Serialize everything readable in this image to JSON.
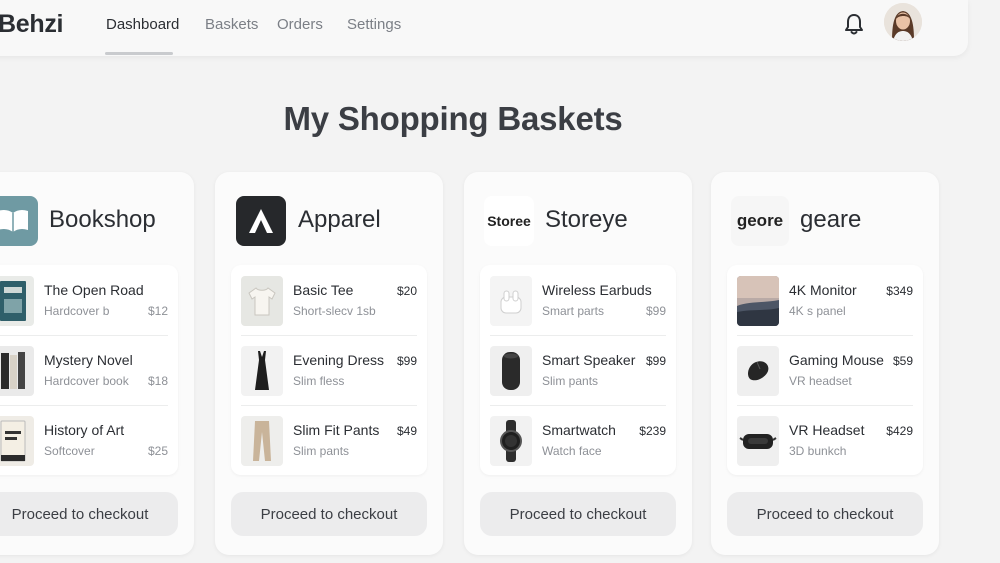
{
  "header": {
    "brand": "Behzi",
    "tabs": [
      {
        "label": "Dashboard",
        "active": true
      },
      {
        "label": "Baskets",
        "active": false
      },
      {
        "label": "Orders",
        "active": false
      },
      {
        "label": "Settings",
        "active": false
      }
    ],
    "icons": {
      "notifications": "bell-icon",
      "profile": "user-avatar"
    }
  },
  "page": {
    "title": "My Shopping Baskets"
  },
  "colors": {
    "background": "#f3f3f3",
    "card": "#fbfbfb",
    "button": "#ececed",
    "text": "#2b2e33"
  },
  "baskets": [
    {
      "store": "Bookshop",
      "logo_text": "",
      "logo_icon": "book-icon",
      "items": [
        {
          "name": "The Open Road",
          "sub": "Hardcover b",
          "price": "$12"
        },
        {
          "name": "Mystery Novel",
          "sub": "Hardcover book",
          "price": "$18"
        },
        {
          "name": "History of Art",
          "sub": "Softcover",
          "price": "$25"
        }
      ],
      "checkout_label": "Proceed to checkout"
    },
    {
      "store": "Apparel",
      "logo_text": "",
      "logo_icon": "letter-a-icon",
      "items": [
        {
          "name": "Basic Tee",
          "sub": "Short-slecv 1sb",
          "price": "$20"
        },
        {
          "name": "Evening Dress",
          "sub": "Slim fless",
          "price": "$99"
        },
        {
          "name": "Slim Fit Pants",
          "sub": "Slim pants",
          "price": "$49"
        }
      ],
      "checkout_label": "Proceed to checkout"
    },
    {
      "store": "Storeye",
      "logo_text": "Storee",
      "logo_icon": "",
      "items": [
        {
          "name": "Wireless Earbuds",
          "sub": "Smart parts",
          "price": "$99"
        },
        {
          "name": "Smart Speaker",
          "sub": "Slim pants",
          "price": "$99"
        },
        {
          "name": "Smartwatch",
          "sub": "Watch face",
          "price": "$239"
        }
      ],
      "checkout_label": "Proceed to checkout"
    },
    {
      "store": "geare",
      "logo_text": "geore",
      "logo_icon": "",
      "items": [
        {
          "name": "4K Monitor",
          "sub": "4K ѕ panel",
          "price": "$349"
        },
        {
          "name": "Gaming Mouse",
          "sub": "VR headset",
          "price": "$59"
        },
        {
          "name": "VR Headset",
          "sub": "3D bunkch",
          "price": "$429"
        }
      ],
      "checkout_label": "Proceed to checkout"
    }
  ]
}
